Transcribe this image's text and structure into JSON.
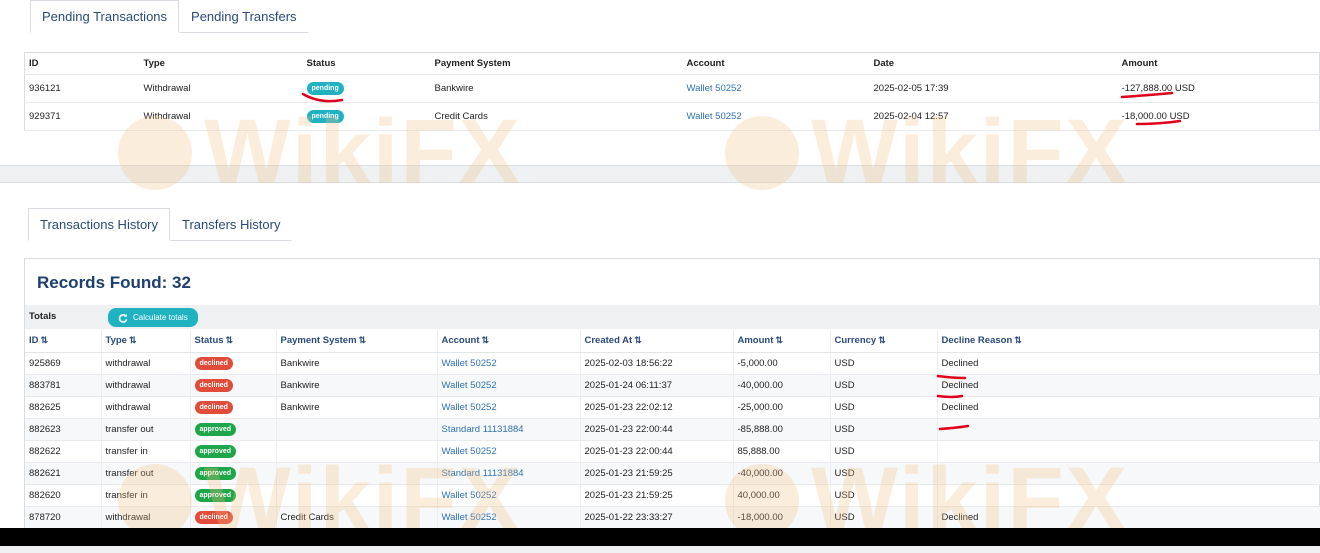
{
  "pending_tabs": [
    {
      "label": "Pending Transactions"
    },
    {
      "label": "Pending Transfers"
    }
  ],
  "pending_table": {
    "headers": [
      "ID",
      "Type",
      "Status",
      "Payment System",
      "Account",
      "Date",
      "Amount"
    ],
    "rows": [
      {
        "id": "936121",
        "type": "Withdrawal",
        "status": "pending",
        "payment_system": "Bankwire",
        "account": "Wallet 50252",
        "date": "2025-02-05 17:39",
        "amount": "-127,888.00 USD"
      },
      {
        "id": "929371",
        "type": "Withdrawal",
        "status": "pending",
        "payment_system": "Credit Cards",
        "account": "Wallet 50252",
        "date": "2025-02-04 12:57",
        "amount": "-18,000.00 USD"
      }
    ]
  },
  "history_tabs": [
    {
      "label": "Transactions History"
    },
    {
      "label": "Transfers History"
    }
  ],
  "records_title": "Records Found: 32",
  "totals_label": "Totals",
  "calculate_button": "Calculate totals",
  "history_table": {
    "headers": [
      "ID",
      "Type",
      "Status",
      "Payment System",
      "Account",
      "Created At",
      "Amount",
      "Currency",
      "Decline Reason"
    ],
    "rows": [
      {
        "id": "925869",
        "type": "withdrawal",
        "status": "declined",
        "payment_system": "Bankwire",
        "account": "Wallet 50252",
        "created_at": "2025-02-03 18:56:22",
        "amount": "-5,000.00",
        "currency": "USD",
        "decline_reason": "Declined"
      },
      {
        "id": "883781",
        "type": "withdrawal",
        "status": "declined",
        "payment_system": "Bankwire",
        "account": "Wallet 50252",
        "created_at": "2025-01-24 06:11:37",
        "amount": "-40,000.00",
        "currency": "USD",
        "decline_reason": "Declined"
      },
      {
        "id": "882625",
        "type": "withdrawal",
        "status": "declined",
        "payment_system": "Bankwire",
        "account": "Wallet 50252",
        "created_at": "2025-01-23 22:02:12",
        "amount": "-25,000.00",
        "currency": "USD",
        "decline_reason": "Declined"
      },
      {
        "id": "882623",
        "type": "transfer out",
        "status": "approved",
        "payment_system": "",
        "account": "Standard 11131884",
        "created_at": "2025-01-23 22:00:44",
        "amount": "-85,888.00",
        "currency": "USD",
        "decline_reason": ""
      },
      {
        "id": "882622",
        "type": "transfer in",
        "status": "approved",
        "payment_system": "",
        "account": "Wallet 50252",
        "created_at": "2025-01-23 22:00:44",
        "amount": "85,888.00",
        "currency": "USD",
        "decline_reason": ""
      },
      {
        "id": "882621",
        "type": "transfer out",
        "status": "approved",
        "payment_system": "",
        "account": "Standard 11131884",
        "created_at": "2025-01-23 21:59:25",
        "amount": "-40,000.00",
        "currency": "USD",
        "decline_reason": ""
      },
      {
        "id": "882620",
        "type": "transfer in",
        "status": "approved",
        "payment_system": "",
        "account": "Wallet 50252",
        "created_at": "2025-01-23 21:59:25",
        "amount": "40,000.00",
        "currency": "USD",
        "decline_reason": ""
      },
      {
        "id": "878720",
        "type": "withdrawal",
        "status": "declined",
        "payment_system": "Credit Cards",
        "account": "Wallet 50252",
        "created_at": "2025-01-22 23:33:27",
        "amount": "-18,000.00",
        "currency": "USD",
        "decline_reason": "Declined"
      }
    ]
  },
  "watermark": "WikiFX",
  "colors": {
    "pending": "#21b2c2",
    "declined": "#e04b3a",
    "approved": "#1fa54a",
    "annotation": "#e0001b",
    "link": "#2f73b3"
  },
  "icons": {
    "sort": "sort-icon",
    "refresh": "refresh-icon"
  }
}
